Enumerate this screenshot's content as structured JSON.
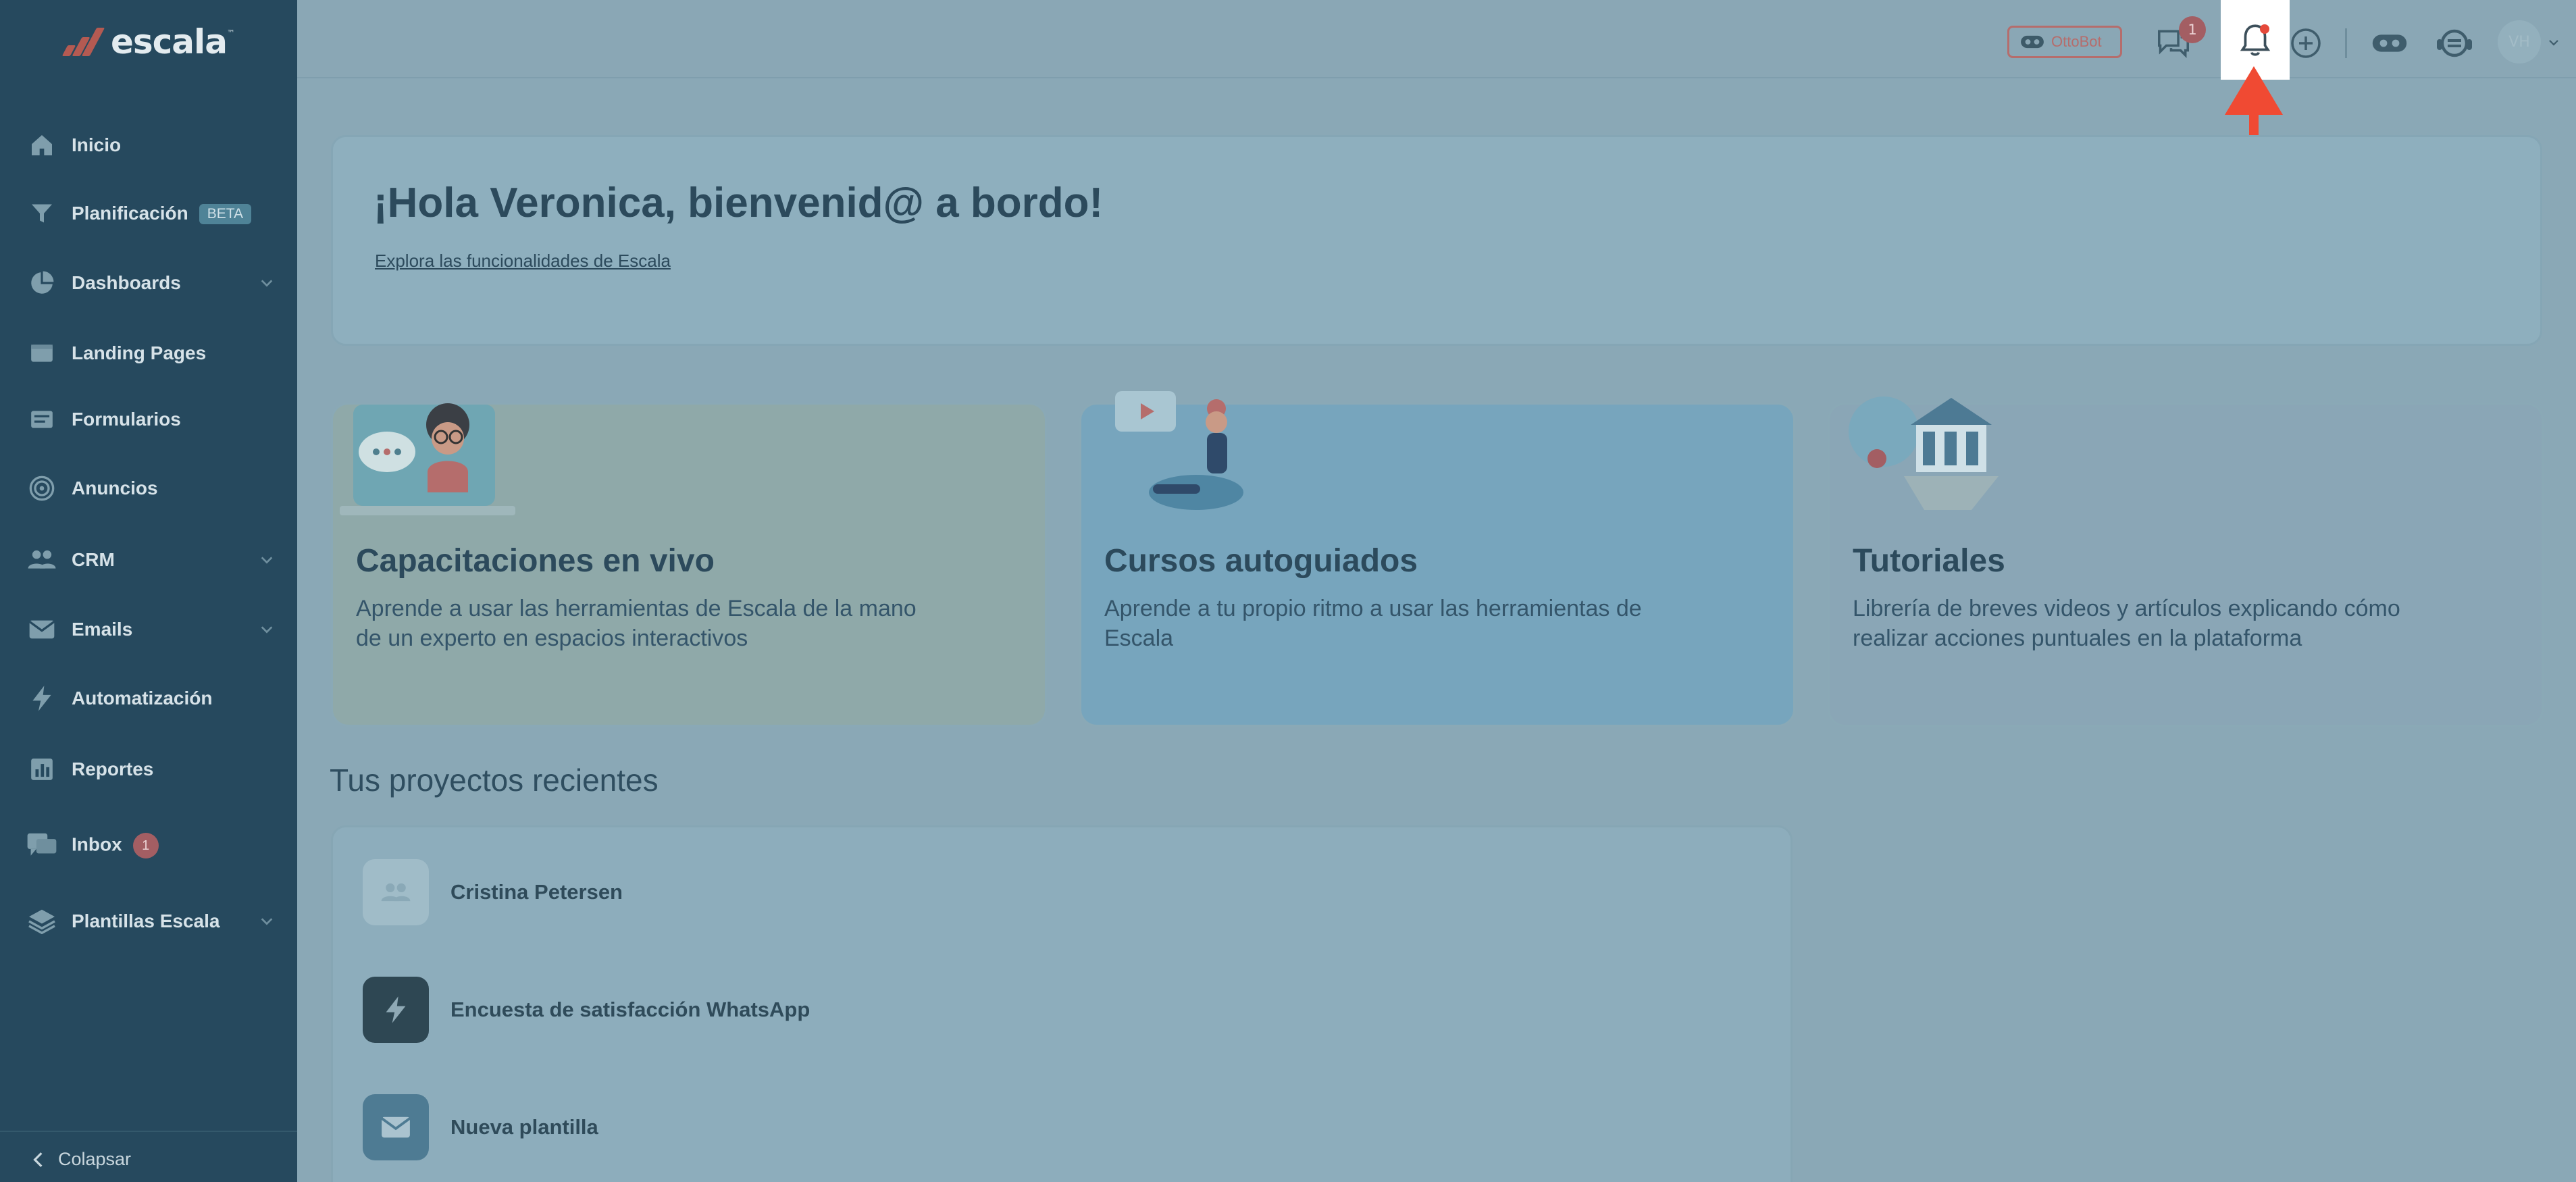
{
  "brand": {
    "name": "escala",
    "accent": "#b45a52"
  },
  "sidebar": {
    "items": [
      {
        "label": "Inicio",
        "icon": "home-icon"
      },
      {
        "label": "Planificación",
        "icon": "funnel-icon",
        "badge": "BETA"
      },
      {
        "label": "Dashboards",
        "icon": "pie-chart-icon",
        "expandable": true
      },
      {
        "label": "Landing Pages",
        "icon": "landing-page-icon"
      },
      {
        "label": "Formularios",
        "icon": "form-icon"
      },
      {
        "label": "Anuncios",
        "icon": "target-icon"
      },
      {
        "label": "CRM",
        "icon": "people-icon",
        "expandable": true
      },
      {
        "label": "Emails",
        "icon": "mail-icon",
        "expandable": true
      },
      {
        "label": "Automatización",
        "icon": "lightning-icon"
      },
      {
        "label": "Reportes",
        "icon": "bar-chart-icon"
      },
      {
        "label": "Inbox",
        "icon": "chat-icon",
        "count": "1"
      },
      {
        "label": "Plantillas Escala",
        "icon": "layers-icon",
        "expandable": true
      }
    ],
    "collapse_label": "Colapsar"
  },
  "header": {
    "ottobot_label": "OttoBot",
    "chat_count": "1",
    "avatar_initials": "VH",
    "highlight_color": "#f04a33"
  },
  "welcome": {
    "title": "¡Hola Veronica, bienvenid@ a bordo!",
    "link": "Explora las funcionalidades de Escala"
  },
  "cards": [
    {
      "title": "Capacitaciones en vivo",
      "desc": "Aprende a usar las herramientas de Escala de la mano de un experto en espacios interactivos",
      "color": "#8fa9a9"
    },
    {
      "title": "Cursos autoguiados",
      "desc": "Aprende a tu propio ritmo a usar las herramientas de Escala",
      "color": "#77a5bd"
    },
    {
      "title": "Tutoriales",
      "desc": "Librería de breves videos y artículos explicando cómo realizar acciones puntuales en la plataforma",
      "color": "#8aa6b6"
    }
  ],
  "recent": {
    "title": "Tus proyectos recientes",
    "items": [
      {
        "label": "Cristina Petersen",
        "icon": "people-icon"
      },
      {
        "label": "Encuesta de satisfacción WhatsApp",
        "icon": "lightning-icon"
      },
      {
        "label": "Nueva plantilla",
        "icon": "mail-icon"
      }
    ]
  }
}
